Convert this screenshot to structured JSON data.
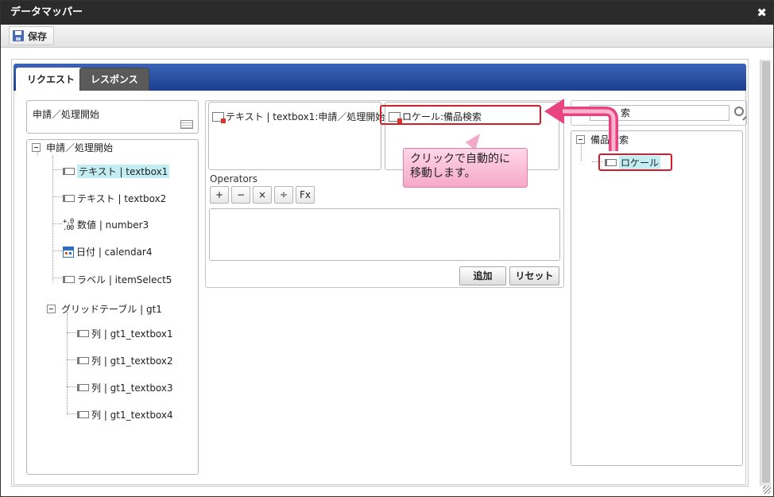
{
  "window": {
    "title": "データマッパー",
    "close_glyph": "✖"
  },
  "toolbar": {
    "save_label": "保存",
    "save_icon": "floppy-disk-icon"
  },
  "tabs": [
    {
      "label": "リクエスト",
      "active": true
    },
    {
      "label": "レスポンス",
      "active": false
    }
  ],
  "source": {
    "header": "申請／処理開始",
    "tree": {
      "root": "申請／処理開始",
      "items": [
        {
          "label": "テキスト | textbox1",
          "icon": "textbox-icon",
          "highlighted": true
        },
        {
          "label": "テキスト | textbox2",
          "icon": "textbox-icon"
        },
        {
          "label": "数値 | number3",
          "icon": "number-icon",
          "icon_glyph": "+.0\n.00"
        },
        {
          "label": "日付 | calendar4",
          "icon": "calendar-icon"
        },
        {
          "label": "ラベル | itemSelect5",
          "icon": "textbox-icon"
        }
      ],
      "grid": {
        "label": "グリッドテーブル | gt1",
        "children": [
          {
            "label": "列 | gt1_textbox1"
          },
          {
            "label": "列 | gt1_textbox2"
          },
          {
            "label": "列 | gt1_textbox3"
          },
          {
            "label": "列 | gt1_textbox4"
          }
        ]
      }
    }
  },
  "mapping": {
    "source_slot": "テキスト | textbox1:申請／処理開始",
    "target_slot": "ロケール:備品検索",
    "operators_label": "Operators",
    "operators": [
      "+",
      "−",
      "×",
      "÷",
      "Fx"
    ],
    "add_label": "追加",
    "reset_label": "リセット"
  },
  "target": {
    "search_value": "索",
    "tree": {
      "root": "備品検索",
      "items": [
        {
          "label": "ロケール",
          "icon": "textbox-icon"
        }
      ]
    }
  },
  "annotation": {
    "callout_line1": "クリックで自動的に",
    "callout_line2": "移動します。",
    "accent": "#d31d2c",
    "callout_color": "#f5a9c9",
    "arrow_color": "#e8447f"
  }
}
